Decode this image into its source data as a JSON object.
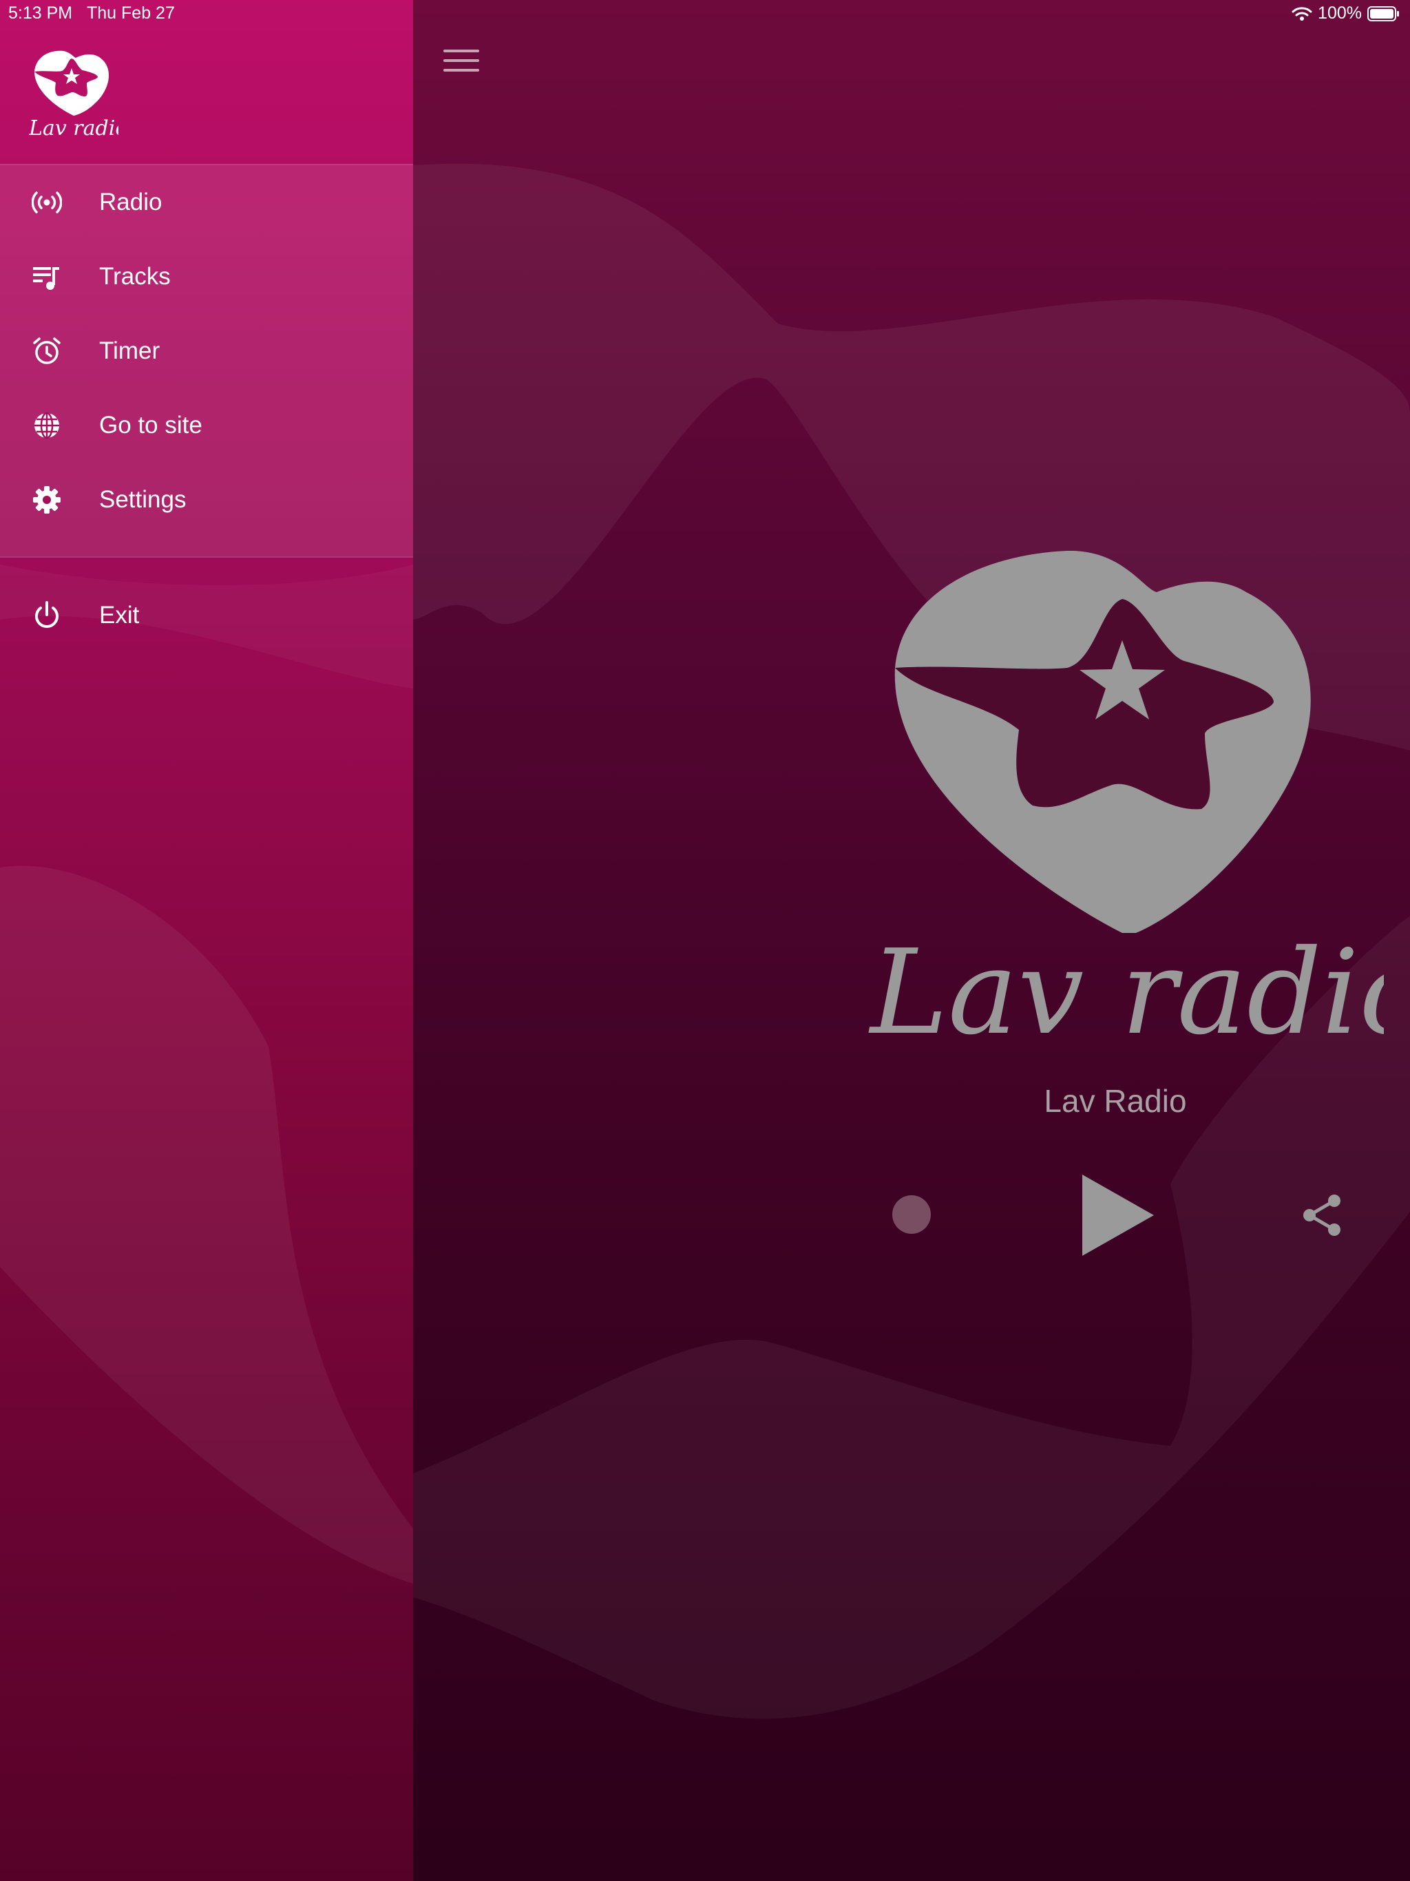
{
  "status_bar": {
    "time": "5:13 PM",
    "date": "Thu Feb 27",
    "battery": "100%",
    "icons": [
      "wifi-icon",
      "battery-icon"
    ]
  },
  "drawer": {
    "logo_text": "Lav radio",
    "menu": [
      {
        "label": "Radio",
        "icon": "radio-broadcast-icon"
      },
      {
        "label": "Tracks",
        "icon": "playlist-icon"
      },
      {
        "label": "Timer",
        "icon": "alarm-clock-icon"
      },
      {
        "label": "Go to site",
        "icon": "globe-icon"
      },
      {
        "label": "Settings",
        "icon": "gear-icon"
      }
    ],
    "exit": {
      "label": "Exit",
      "icon": "power-icon"
    }
  },
  "player": {
    "logo_text": "Lav radio",
    "station_name": "Lav Radio",
    "controls": [
      "record-dot",
      "play-icon",
      "share-icon"
    ]
  },
  "colors": {
    "drawer_top": "#bd0f68",
    "drawer_bottom": "#560228",
    "main_top": "#6e0a3c",
    "main_bottom": "#2c0019",
    "logo_gray": "#9a9a9a",
    "text_white": "#ffffff"
  }
}
